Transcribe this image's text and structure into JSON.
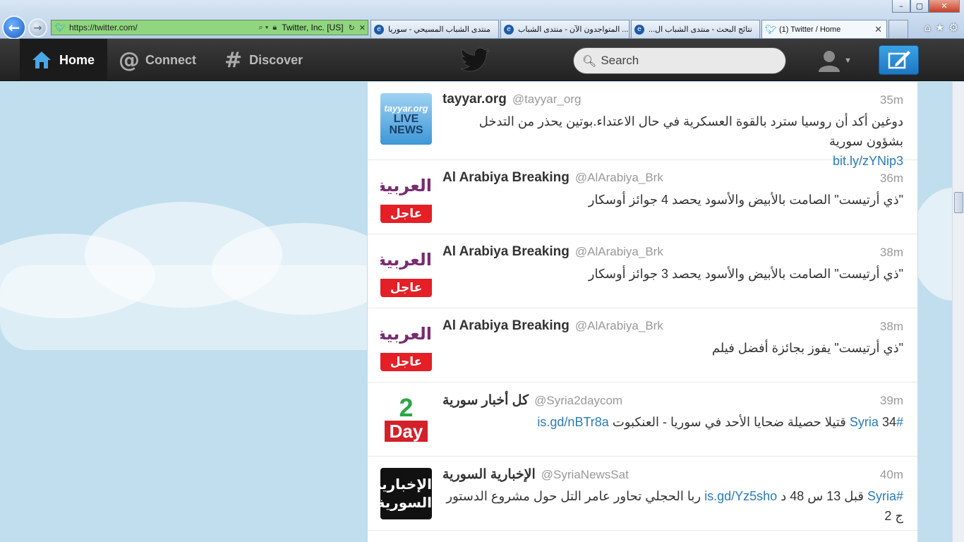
{
  "browser": {
    "address": "https://twitter.com/",
    "cert_label": "Twitter, Inc. [US]",
    "tabs": [
      {
        "label": "منتدى الشباب المسيحي - سوريا",
        "active": false
      },
      {
        "label": "... المتواجدون الآن - منتدى الشباب",
        "active": false
      },
      {
        "label": "نتائج البحث - منتدى الشباب ال...",
        "active": false
      },
      {
        "label": "(1) Twitter / Home",
        "active": true
      }
    ],
    "window_controls": [
      "–",
      "▢",
      "✕"
    ]
  },
  "topbar": {
    "home_label": "Home",
    "connect_label": "Connect",
    "discover_label": "Discover",
    "search_placeholder": "Search"
  },
  "tweets": [
    {
      "name": "tayyar.org",
      "handle": "@tayyar_org",
      "time": "35m",
      "text": "دوغين أكد أن روسيا سترد بالقوة العسكرية في حال الاعتداء.بوتين يحذر من التدخل بشؤون سورية",
      "link": "bit.ly/zYNip3",
      "avatar": "tayyar-avatar",
      "avatar_text": [
        "tayyar.org",
        "LIVE",
        "NEWS"
      ]
    },
    {
      "name": "Al Arabiya Breaking",
      "handle": "@AlArabiya_Brk",
      "time": "36m",
      "text": "\"ذي أرتيست\" الصامت بالأبيض والأسود يحصد 4 جوائز أوسكار",
      "avatar": "alarabiya-avatar",
      "avatar_text": [
        "العربية",
        "عاجل"
      ]
    },
    {
      "name": "Al Arabiya Breaking",
      "handle": "@AlArabiya_Brk",
      "time": "38m",
      "text": "\"ذي أرتيست\" الصامت بالأبيض والأسود يحصد 3 جوائز أوسكار",
      "avatar": "alarabiya-avatar",
      "avatar_text": [
        "العربية",
        "عاجل"
      ]
    },
    {
      "name": "Al Arabiya Breaking",
      "handle": "@AlArabiya_Brk",
      "time": "38m",
      "text": "\"ذي أرتيست\" يفوز بجائزة أفضل فيلم",
      "avatar": "alarabiya-avatar",
      "avatar_text": [
        "العربية",
        "عاجل"
      ]
    },
    {
      "name": "كل أخبار سورية",
      "handle": "@Syria2daycom",
      "time": "39m",
      "hashtag": "#Syria",
      "text": "34 قتيلا حصيلة ضحايا الأحد في سوريا - العنكبوت",
      "link": "is.gd/nBTr8a",
      "avatar": "syria2day-avatar",
      "avatar_text": [
        "2",
        "Day"
      ]
    },
    {
      "name": "الإخبارية السورية",
      "handle": "@SyriaNewsSat",
      "time": "40m",
      "hashtag": "#Syria",
      "text_pre": "قبل 13 س 48 د",
      "link": "is.gd/Yz5sho",
      "text": "ربا الحجلي تحاور عامر التل حول مشروع الدستور ج 2",
      "avatar": "syrianewssat-avatar",
      "avatar_text": [
        "الإخبارية",
        "السورية"
      ]
    }
  ]
}
